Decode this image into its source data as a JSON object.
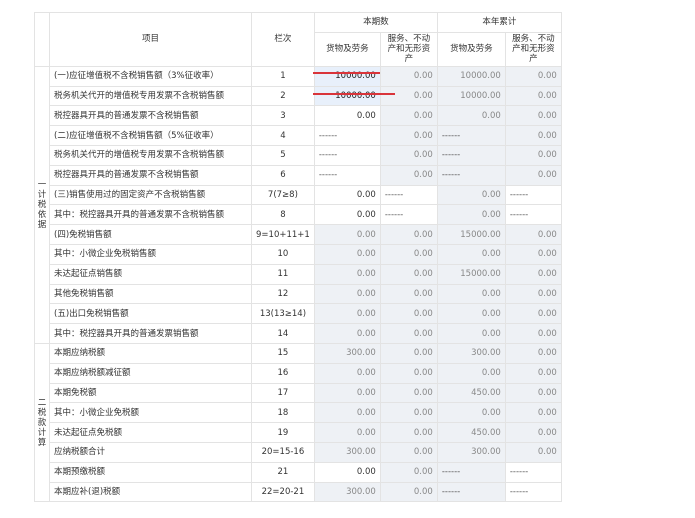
{
  "header": {
    "item": "项目",
    "line_no": "栏次",
    "current_period": "本期数",
    "year_to_date": "本年累计",
    "goods_services": "货物及劳务",
    "services_assets": "服务、不动产和无形资产"
  },
  "sections": {
    "tax_basis": "一计税依据",
    "tax_calc": "二税款计算"
  },
  "rows": [
    {
      "item": "(一)应征增值税不含税销售额（3%征收率）",
      "line": "1",
      "c1": "10000.00",
      "c2": "0.00",
      "c3": "10000.00",
      "c4": "0.00"
    },
    {
      "item": "税务机关代开的增值税专用发票不含税销售额",
      "line": "2",
      "c1": "10000.00",
      "c2": "0.00",
      "c3": "10000.00",
      "c4": "0.00"
    },
    {
      "item": "税控器具开具的普通发票不含税销售额",
      "line": "3",
      "c1": "0.00",
      "c2": "0.00",
      "c3": "0.00",
      "c4": "0.00"
    },
    {
      "item": "(二)应征增值税不含税销售额（5%征收率）",
      "line": "4",
      "c1": "------",
      "c2": "0.00",
      "c3": "------",
      "c4": "0.00"
    },
    {
      "item": "税务机关代开的增值税专用发票不含税销售额",
      "line": "5",
      "c1": "------",
      "c2": "0.00",
      "c3": "------",
      "c4": "0.00"
    },
    {
      "item": "税控器具开具的普通发票不含税销售额",
      "line": "6",
      "c1": "------",
      "c2": "0.00",
      "c3": "------",
      "c4": "0.00"
    },
    {
      "item": "(三)销售使用过的固定资产不含税销售额",
      "line": "7(7≥8)",
      "c1": "0.00",
      "c2": "------",
      "c3": "0.00",
      "c4": "------"
    },
    {
      "item": "其中：税控器具开具的普通发票不含税销售额",
      "line": "8",
      "c1": "0.00",
      "c2": "------",
      "c3": "0.00",
      "c4": "------"
    },
    {
      "item": "(四)免税销售额",
      "line": "9=10+11+1",
      "c1": "0.00",
      "c2": "0.00",
      "c3": "15000.00",
      "c4": "0.00"
    },
    {
      "item": "其中：小微企业免税销售额",
      "line": "10",
      "c1": "0.00",
      "c2": "0.00",
      "c3": "0.00",
      "c4": "0.00"
    },
    {
      "item": "未达起征点销售额",
      "line": "11",
      "c1": "0.00",
      "c2": "0.00",
      "c3": "15000.00",
      "c4": "0.00"
    },
    {
      "item": "其他免税销售额",
      "line": "12",
      "c1": "0.00",
      "c2": "0.00",
      "c3": "0.00",
      "c4": "0.00"
    },
    {
      "item": "(五)出口免税销售额",
      "line": "13(13≥14)",
      "c1": "0.00",
      "c2": "0.00",
      "c3": "0.00",
      "c4": "0.00"
    },
    {
      "item": "其中：税控器具开具的普通发票销售额",
      "line": "14",
      "c1": "0.00",
      "c2": "0.00",
      "c3": "0.00",
      "c4": "0.00"
    },
    {
      "item": "本期应纳税额",
      "line": "15",
      "c1": "300.00",
      "c2": "0.00",
      "c3": "300.00",
      "c4": "0.00"
    },
    {
      "item": "本期应纳税额减征额",
      "line": "16",
      "c1": "0.00",
      "c2": "0.00",
      "c3": "0.00",
      "c4": "0.00"
    },
    {
      "item": "本期免税额",
      "line": "17",
      "c1": "0.00",
      "c2": "0.00",
      "c3": "450.00",
      "c4": "0.00"
    },
    {
      "item": "其中：小微企业免税额",
      "line": "18",
      "c1": "0.00",
      "c2": "0.00",
      "c3": "0.00",
      "c4": "0.00"
    },
    {
      "item": "未达起征点免税额",
      "line": "19",
      "c1": "0.00",
      "c2": "0.00",
      "c3": "450.00",
      "c4": "0.00"
    },
    {
      "item": "应纳税额合计",
      "line": "20=15-16",
      "c1": "300.00",
      "c2": "0.00",
      "c3": "300.00",
      "c4": "0.00"
    },
    {
      "item": "本期预缴税额",
      "line": "21",
      "c1": "0.00",
      "c2": "0.00",
      "c3": "------",
      "c4": "------"
    },
    {
      "item": "本期应补(退)税额",
      "line": "22=20-21",
      "c1": "300.00",
      "c2": "0.00",
      "c3": "------",
      "c4": "------"
    }
  ]
}
